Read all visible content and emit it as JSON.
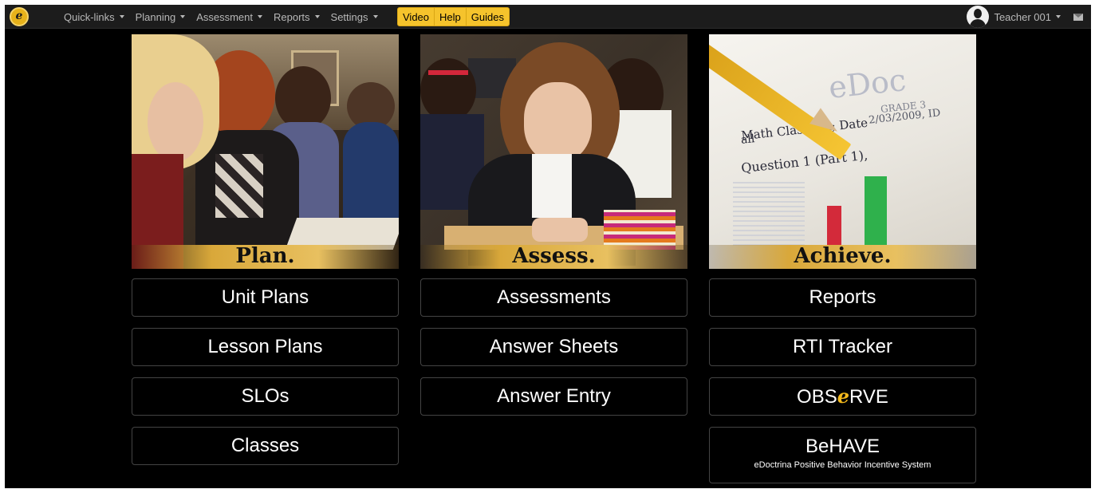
{
  "navbar": {
    "logo_letter": "e",
    "menu": [
      {
        "label": "Quick-links"
      },
      {
        "label": "Planning"
      },
      {
        "label": "Assessment"
      },
      {
        "label": "Reports"
      },
      {
        "label": "Settings"
      }
    ],
    "help_buttons": [
      {
        "label": "Video"
      },
      {
        "label": "Help"
      },
      {
        "label": "Guides"
      }
    ],
    "user_name": "Teacher 001",
    "icons": {
      "logo": "edoctrina-logo-icon",
      "avatar": "user-avatar-icon",
      "mail": "envelope-icon",
      "dropdown": "caret-down-icon"
    },
    "accent_color": "#f5c32c"
  },
  "columns": {
    "plan": {
      "caption": "Plan.",
      "buttons": [
        {
          "label": "Unit Plans"
        },
        {
          "label": "Lesson Plans"
        },
        {
          "label": "SLOs"
        },
        {
          "label": "Classes"
        }
      ]
    },
    "assess": {
      "caption": "Assess.",
      "buttons": [
        {
          "label": "Assessments"
        },
        {
          "label": "Answer Sheets"
        },
        {
          "label": "Answer Entry"
        }
      ]
    },
    "achieve": {
      "caption": "Achieve.",
      "image_text": {
        "line1": "eDoc",
        "line2": "GRADE 3",
        "line3": "2/03/2009, ID",
        "line4": "Math Class: all; Date",
        "line5": "all",
        "line6": "Question 1 (Part 1),"
      },
      "buttons": [
        {
          "label": "Reports"
        },
        {
          "label": "RTI Tracker"
        },
        {
          "label_pre": "OBS",
          "label_accent": "e",
          "label_post": "RVE"
        },
        {
          "label": "BeHAVE",
          "sublabel": "eDoctrina Positive Behavior Incentive System"
        }
      ]
    }
  }
}
